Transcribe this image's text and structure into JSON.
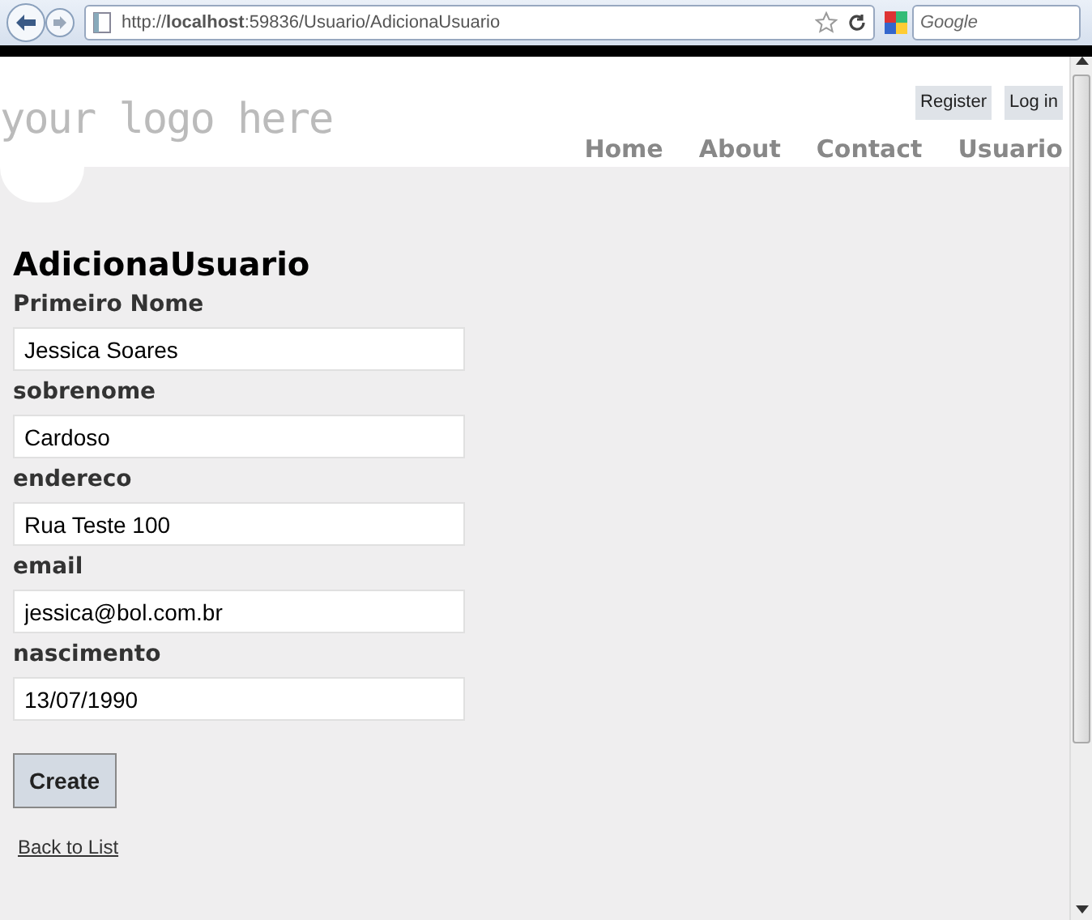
{
  "browser": {
    "address": "http://**localhost**:59836/Usuario/AdicionaUsuario",
    "search_placeholder": "Google"
  },
  "header": {
    "logo": "your logo here",
    "account_links": [
      "Register",
      "Log in"
    ],
    "menu": [
      "Home",
      "About",
      "Contact",
      "Usuario"
    ]
  },
  "page": {
    "title": "AdicionaUsuario",
    "fields": [
      {
        "label": "Primeiro Nome",
        "value": "Jessica Soares"
      },
      {
        "label": "sobrenome",
        "value": "Cardoso"
      },
      {
        "label": "endereco",
        "value": "Rua Teste 100"
      },
      {
        "label": "email",
        "value": "jessica@bol.com.br"
      },
      {
        "label": "nascimento",
        "value": "13/07/1990"
      }
    ],
    "submit": "Create",
    "back_link": "Back to List"
  }
}
